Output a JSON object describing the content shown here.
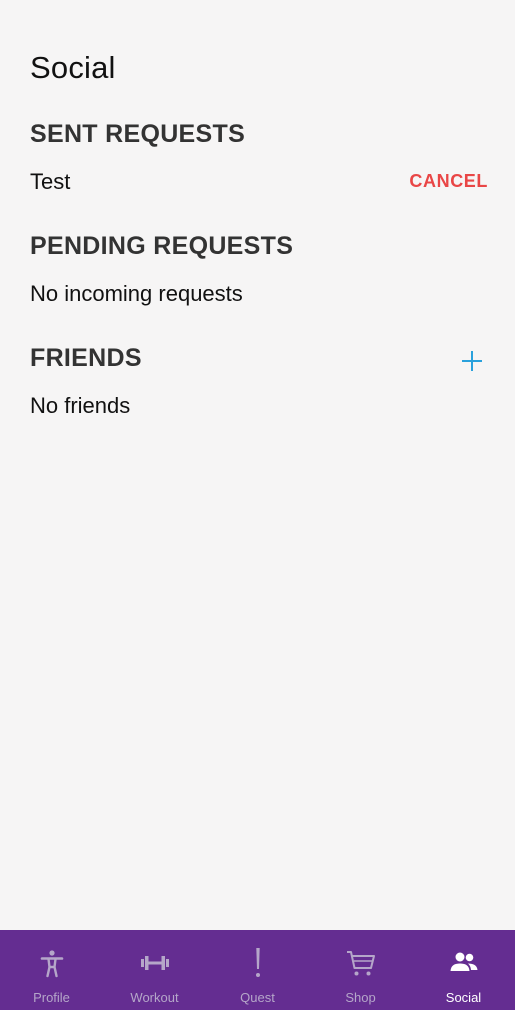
{
  "header": {
    "title": "Social"
  },
  "sent_requests": {
    "heading": "SENT REQUESTS",
    "items": [
      {
        "name": "Test",
        "action_label": "CANCEL"
      }
    ]
  },
  "pending_requests": {
    "heading": "PENDING REQUESTS",
    "empty_text": "No incoming requests"
  },
  "friends": {
    "heading": "FRIENDS",
    "add_icon": "plus-icon",
    "empty_text": "No friends"
  },
  "bottom_nav": {
    "items": [
      {
        "label": "Profile",
        "icon": "person-icon",
        "active": false
      },
      {
        "label": "Workout",
        "icon": "dumbbell-icon",
        "active": false
      },
      {
        "label": "Quest",
        "icon": "exclamation-icon",
        "active": false
      },
      {
        "label": "Shop",
        "icon": "cart-icon",
        "active": false
      },
      {
        "label": "Social",
        "icon": "people-icon",
        "active": true
      }
    ]
  },
  "colors": {
    "accent_nav": "#642d91",
    "cancel": "#e94646",
    "add": "#2aa1dc",
    "nav_inactive": "#b5a6c9",
    "nav_active": "#ffffff"
  }
}
